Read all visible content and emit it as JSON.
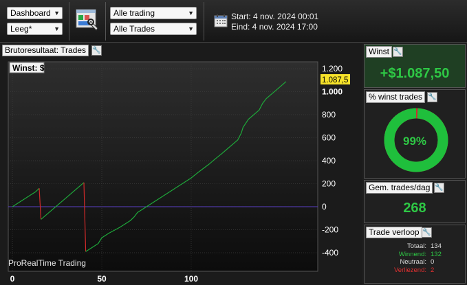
{
  "toolbar": {
    "dashboard_select": "Dashboard",
    "leeg_select": "Leeg*",
    "trading_select": "Alle trading",
    "trades_select": "Alle Trades",
    "start_label": "Start: 4 nov. 2024 00:01",
    "end_label": "Eind: 4 nov. 2024 17:00"
  },
  "chart_panel": {
    "title": "Brutoresultaat: Trades",
    "legend": "Winst: $",
    "watermark": "ProRealTime Trading",
    "current_value_tag": "1.087,5"
  },
  "chart_data": {
    "type": "line",
    "x_ticks": [
      "0",
      "50",
      "100"
    ],
    "y_ticks": [
      "-400",
      "-200",
      "0",
      "200",
      "400",
      "600",
      "800",
      "1.000",
      "1.200"
    ],
    "xlim": [
      -2,
      142
    ],
    "ylim": [
      -520,
      1240
    ],
    "zero_line_color": "#5a3fc6",
    "series": [
      {
        "points": [
          [
            0,
            0
          ],
          [
            5,
            50
          ],
          [
            10,
            100
          ],
          [
            13,
            130
          ],
          [
            15,
            160
          ]
        ],
        "color": "#1ea83a"
      },
      {
        "points": [
          [
            15,
            160
          ],
          [
            16,
            -110
          ]
        ],
        "color": "#d42a2a"
      },
      {
        "points": [
          [
            16,
            -110
          ],
          [
            40,
            210
          ]
        ],
        "color": "#1ea83a"
      },
      {
        "points": [
          [
            40,
            210
          ],
          [
            41,
            -390
          ]
        ],
        "color": "#d42a2a"
      },
      {
        "points": [
          [
            41,
            -390
          ],
          [
            43,
            -370
          ],
          [
            46,
            -340
          ],
          [
            48,
            -320
          ],
          [
            50,
            -270
          ],
          [
            54,
            -230
          ],
          [
            60,
            -180
          ],
          [
            64,
            -140
          ],
          [
            66,
            -120
          ],
          [
            68,
            -90
          ],
          [
            70,
            -50
          ],
          [
            72,
            -30
          ],
          [
            75,
            0
          ],
          [
            80,
            50
          ],
          [
            85,
            100
          ],
          [
            90,
            150
          ],
          [
            95,
            200
          ],
          [
            100,
            250
          ],
          [
            104,
            300
          ],
          [
            110,
            370
          ],
          [
            113,
            410
          ],
          [
            117,
            460
          ],
          [
            120,
            500
          ],
          [
            123,
            540
          ],
          [
            126,
            580
          ],
          [
            128,
            640
          ],
          [
            129,
            690
          ],
          [
            132,
            760
          ],
          [
            135,
            800
          ],
          [
            138,
            840
          ],
          [
            140,
            900
          ],
          [
            142,
            940
          ],
          [
            145,
            980
          ],
          [
            148,
            1020
          ],
          [
            151,
            1060
          ],
          [
            153,
            1087.5
          ]
        ],
        "color": "#1ea83a"
      }
    ]
  },
  "cards": {
    "winst": {
      "title": "Winst",
      "value": "+$1.087,50",
      "color": "#2ec845"
    },
    "winst_pct": {
      "title": "% winst trades",
      "value": "99%",
      "fraction": 0.99
    },
    "gem": {
      "title": "Gem. trades/dag",
      "value": "268"
    },
    "verloop": {
      "title": "Trade verloop",
      "rows": [
        {
          "label": "Totaal:",
          "value": "134",
          "color": "#dddddd"
        },
        {
          "label": "Winnend:",
          "value": "132",
          "color": "#2ec845"
        },
        {
          "label": "Neutraal:",
          "value": "0",
          "color": "#dddddd"
        },
        {
          "label": "Verliezend:",
          "value": "2",
          "color": "#e03030"
        }
      ]
    }
  }
}
